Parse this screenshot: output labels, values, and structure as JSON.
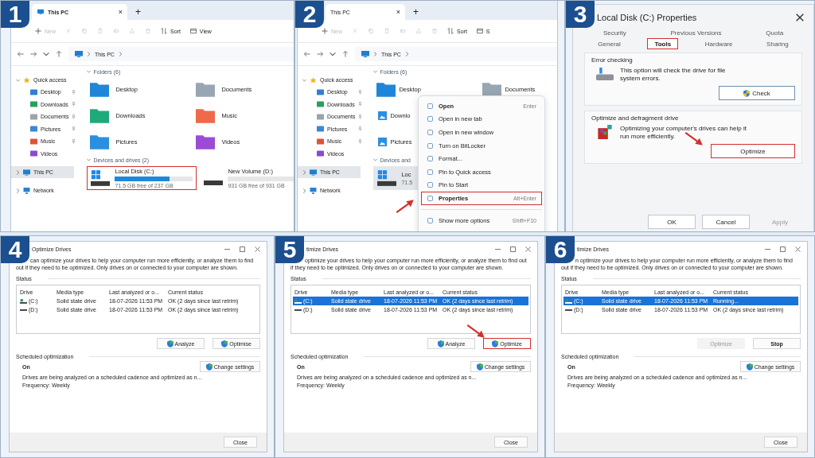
{
  "steps": [
    {
      "badge": "1",
      "kind": "explorer",
      "tab": {
        "title": "This PC",
        "close": "×",
        "add": "+",
        "show_icon": true
      },
      "toolbar": {
        "new": "New",
        "sort": "Sort",
        "view": "View"
      },
      "breadcrumb": "This PC",
      "nav": [
        {
          "label": "Quick access",
          "kind": "quick",
          "expanded": true,
          "selected": false,
          "children": [
            {
              "label": "Desktop",
              "color": "#2f7fd6",
              "pinned": true
            },
            {
              "label": "Downloads",
              "color": "#2aa05a",
              "pinned": true
            },
            {
              "label": "Documents",
              "color": "#9aa4ae",
              "pinned": true
            },
            {
              "label": "Pictures",
              "color": "#3a86d8",
              "pinned": true
            },
            {
              "label": "Music",
              "color": "#e0523a",
              "pinned": true
            },
            {
              "label": "Videos",
              "color": "#8a4bd0",
              "pinned": false
            }
          ]
        },
        {
          "label": "This PC",
          "kind": "pc",
          "expanded": false,
          "selected": true
        },
        {
          "label": "Network",
          "kind": "network",
          "expanded": false,
          "selected": false
        }
      ],
      "folders_header": "Folders (6)",
      "folders": [
        {
          "name": "Desktop",
          "kind": "folder",
          "color": "#1f86d9"
        },
        {
          "name": "Documents",
          "kind": "folder",
          "color": "#98a6b4"
        },
        {
          "name": "Downloads",
          "kind": "folder",
          "color": "#1faa7a"
        },
        {
          "name": "Music",
          "kind": "folder",
          "color": "#ee6a4a"
        },
        {
          "name": "Pictures",
          "kind": "folder",
          "color": "#2b8fe0"
        },
        {
          "name": "Videos",
          "kind": "folder",
          "color": "#9b4bd6"
        }
      ],
      "drives_header": "Devices and drives (2)",
      "drives": [
        {
          "name": "Local Disk (C:)",
          "kind": "system",
          "level": 0.7,
          "free": "71.5 GB free of 237 GB",
          "selected": false,
          "highlighted": true
        },
        {
          "name": "New Volume (D:)",
          "kind": "data",
          "level": 0,
          "free": "931 GB free of 931 GB",
          "selected": false,
          "highlighted": false
        }
      ]
    },
    {
      "badge": "2",
      "kind": "explorer",
      "tab": {
        "title": "This PC",
        "close": "×",
        "add": "+",
        "show_icon": false
      },
      "toolbar": {
        "new": "New",
        "sort": "Sort",
        "view": "S"
      },
      "breadcrumb": "This PC",
      "nav": [
        {
          "label": "Quick access",
          "kind": "quick",
          "expanded": true,
          "selected": false,
          "children": [
            {
              "label": "Desktop",
              "color": "#2f7fd6",
              "pinned": true
            },
            {
              "label": "Downloads",
              "color": "#2aa05a",
              "pinned": true
            },
            {
              "label": "Documents",
              "color": "#9aa4ae",
              "pinned": true
            },
            {
              "label": "Pictures",
              "color": "#3a86d8",
              "pinned": true
            },
            {
              "label": "Music",
              "color": "#e0523a",
              "pinned": true
            },
            {
              "label": "Videos",
              "color": "#8a4bd0",
              "pinned": false
            }
          ]
        },
        {
          "label": "This PC",
          "kind": "pc",
          "expanded": false,
          "selected": true
        },
        {
          "label": "Network",
          "kind": "network",
          "expanded": false,
          "selected": false
        }
      ],
      "folders_header": "Folders (6)",
      "folders": [
        {
          "name": "Desktop",
          "kind": "folder",
          "color": "#1f86d9"
        },
        {
          "name": "Documents",
          "kind": "folder",
          "color": "#98a6b4"
        },
        {
          "name": "Downlo",
          "kind": "image",
          "color": "#2b8fe0"
        },
        {
          "name": "Pictures",
          "kind": "image",
          "color": "#2b8fe0"
        }
      ],
      "drives_header": "Devices and",
      "drives": [
        {
          "name": "Loc",
          "kind": "system",
          "free": "71.5",
          "selected": true,
          "highlighted": false
        }
      ],
      "menu": [
        {
          "label": "Open",
          "shortcut": "Enter",
          "bold": true,
          "highlighted": false
        },
        {
          "label": "Open in new tab",
          "bold": false,
          "highlighted": false
        },
        {
          "label": "Open in new window",
          "bold": false,
          "highlighted": false
        },
        {
          "label": "Turn on BitLocker",
          "bold": false,
          "highlighted": false
        },
        {
          "label": "Format...",
          "bold": false,
          "highlighted": false
        },
        {
          "label": "Pin to Quick access",
          "bold": false,
          "highlighted": false
        },
        {
          "label": "Pin to Start",
          "bold": false,
          "highlighted": false
        },
        {
          "label": "Properties",
          "shortcut": "Alt+Enter",
          "bold": true,
          "highlighted": true,
          "arrow": true
        },
        {
          "label": "Show more options",
          "shortcut": "Shift+F10",
          "bold": false,
          "highlighted": false,
          "divider_before": true
        }
      ]
    },
    {
      "badge": "3",
      "kind": "properties",
      "title": "Local Disk (C:) Properties",
      "tab_rows": [
        [
          {
            "label": "Security",
            "selected": false,
            "highlighted": false
          },
          {
            "label": "Previous Versions",
            "selected": false,
            "highlighted": false
          },
          {
            "label": "Quota",
            "selected": false,
            "highlighted": false
          }
        ],
        [
          {
            "label": "General",
            "selected": false,
            "highlighted": false
          },
          {
            "label": "Tools",
            "selected": true,
            "highlighted": true
          },
          {
            "label": "Hardware",
            "selected": false,
            "highlighted": false
          },
          {
            "label": "Sharing",
            "selected": false,
            "highlighted": false
          }
        ]
      ],
      "groups": [
        {
          "title": "Error checking",
          "kind": "check",
          "text": "This option will check the drive for file system errors.",
          "button": {
            "label": "Check",
            "shield": true,
            "highlighted": false
          }
        },
        {
          "title": "Optimize and defragment drive",
          "kind": "defrag",
          "text": "Optimizing your computer's drives can help it run more efficiently.",
          "button": {
            "label": "Optimize",
            "shield": false,
            "highlighted": true,
            "arrow": true
          }
        }
      ],
      "footer": [
        {
          "label": "OK",
          "disabled": false
        },
        {
          "label": "Cancel",
          "disabled": false
        },
        {
          "label": "Apply",
          "disabled": true
        }
      ]
    },
    {
      "badge": "4",
      "kind": "optimize",
      "title": "Optimize Drives",
      "intro": "can optimize your drives to help your computer run more efficiently, or analyze them to find out if they need to be optimized. Only drives on or connected to your computer are shown.",
      "status_label": "Status",
      "columns": [
        "Drive",
        "Media type",
        "Last analyzed or o...",
        "Current status"
      ],
      "rows": [
        {
          "kind": "system",
          "selected": false,
          "cells": [
            "(C:)",
            "Solid state drive",
            "18-07-2026 11:53 PM",
            "OK (2 days since last retrim)"
          ]
        },
        {
          "kind": "data",
          "selected": false,
          "cells": [
            "(D:)",
            "Solid state drive",
            "18-07-2026 11:53 PM",
            "OK (2 days since last retrim)"
          ]
        }
      ],
      "actions": [
        {
          "label": "Analyze",
          "shield": true,
          "disabled": false,
          "bold": false,
          "highlighted": false
        },
        {
          "label": "Optimise",
          "shield": true,
          "disabled": false,
          "bold": false,
          "highlighted": false
        }
      ],
      "schedule_label": "Scheduled optimization",
      "schedule_state": "On",
      "schedule_text": "Drives are being analyzed on a scheduled cadence and optimized as n...",
      "frequency": "Frequency: Weekly",
      "change_settings": "Change settings",
      "close_button": "Close"
    },
    {
      "badge": "5",
      "kind": "optimize",
      "title": "timize Drives",
      "intro": "optimize your drives to help your computer run more efficiently, or analyze them to find out if they need to be optimized. Only drives on or connected to your computer are shown.",
      "status_label": "Status",
      "columns": [
        "Drive",
        "Media type",
        "Last analyzed or o...",
        "Current status"
      ],
      "rows": [
        {
          "kind": "system",
          "selected": true,
          "cells": [
            "(C:)",
            "Solid state drive",
            "18-07-2026 11:53 PM",
            "OK (2 days since last retrim)"
          ]
        },
        {
          "kind": "data",
          "selected": false,
          "cells": [
            "(D:)",
            "Solid state drive",
            "18-07-2026 11:53 PM",
            "OK (2 days since last retrim)"
          ]
        }
      ],
      "actions": [
        {
          "label": "Analyze",
          "shield": true,
          "disabled": false,
          "bold": false,
          "highlighted": false
        },
        {
          "label": "Optimize",
          "shield": true,
          "disabled": false,
          "bold": false,
          "highlighted": true,
          "arrow": true
        }
      ],
      "schedule_label": "Scheduled optimization",
      "schedule_state": "On",
      "schedule_text": "Drives are being analyzed on a scheduled cadence and optimized as n...",
      "frequency": "Frequency: Weekly",
      "change_settings": "Change settings",
      "close_button": "Close"
    },
    {
      "badge": "6",
      "kind": "optimize",
      "title": "timize Drives",
      "intro": "n optimize your drives to help your computer run more efficiently, or analyze them to find out if they need to be optimized. Only drives on or connected to your computer are shown.",
      "status_label": "Status",
      "columns": [
        "Drive",
        "Media type",
        "Last analyzed or o...",
        "Current status"
      ],
      "rows": [
        {
          "kind": "system",
          "selected": true,
          "cells": [
            "(C:)",
            "Solid state drive",
            "18-07-2026 11:53 PM",
            "Running..."
          ]
        },
        {
          "kind": "data",
          "selected": false,
          "cells": [
            "(D:)",
            "Solid state drive",
            "18-07-2026 11:53 PM",
            "OK (2 days since last retrim)"
          ]
        }
      ],
      "actions": [
        {
          "label": "Optimize",
          "shield": false,
          "disabled": true,
          "bold": false,
          "highlighted": false
        },
        {
          "label": "Stop",
          "shield": false,
          "disabled": false,
          "bold": true,
          "highlighted": false
        }
      ],
      "schedule_label": "Scheduled optimization",
      "schedule_state": "On",
      "schedule_text": "Drives are being analyzed on a scheduled cadence and optimized as n...",
      "frequency": "Frequency: Weekly",
      "change_settings": "Change settings",
      "close_button": "Close"
    }
  ]
}
